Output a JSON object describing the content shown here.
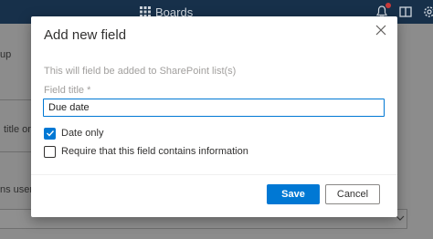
{
  "background": {
    "app_title": "Boards",
    "left_fragments": [
      "up",
      "title on",
      "ns users"
    ]
  },
  "dialog": {
    "title": "Add new field",
    "info": "This will field be added to SharePoint list(s)",
    "field_title_label": "Field title *",
    "field_title_value": "Due date",
    "checkbox_date_only": {
      "label": "Date only",
      "checked": true
    },
    "checkbox_required": {
      "label": "Require that this field contains information",
      "checked": false
    },
    "save_label": "Save",
    "cancel_label": "Cancel"
  },
  "colors": {
    "accent": "#0078d4",
    "header_bg": "#17304a"
  }
}
